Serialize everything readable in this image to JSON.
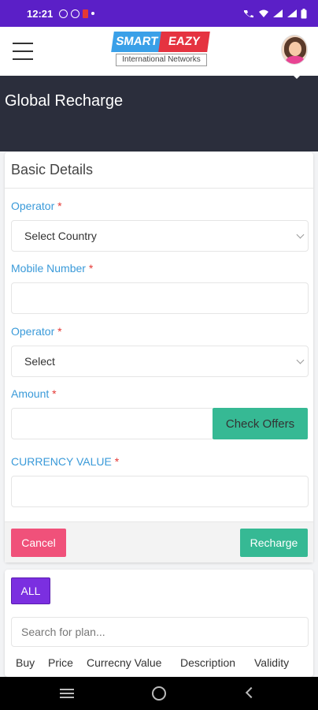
{
  "statusbar": {
    "time": "12:21"
  },
  "header": {
    "logo_left": "SMART",
    "logo_right": "EAZY",
    "logo_sub": "International Networks"
  },
  "page": {
    "title": "Global Recharge"
  },
  "form": {
    "section_title": "Basic Details",
    "operator_country_label": "Operator",
    "country_select_value": "Select Country",
    "mobile_label": "Mobile Number",
    "mobile_value": "",
    "operator_label": "Operator",
    "operator_select_value": "Select",
    "amount_label": "Amount",
    "amount_value": "",
    "check_offers": "Check Offers",
    "currency_label": "CURRENCY VALUE",
    "currency_value": "",
    "required_mark": "*",
    "cancel": "Cancel",
    "recharge": "Recharge"
  },
  "plans": {
    "all_button": "ALL",
    "search_placeholder": "Search for plan...",
    "columns": [
      "Buy",
      "Price",
      "Currecny Value",
      "Description",
      "Validity"
    ]
  },
  "colors": {
    "statusbar": "#5b1fc7",
    "banner": "#2b2e3c",
    "label": "#3a9ad9",
    "success": "#36b994",
    "danger": "#f0517a",
    "all_button": "#7b2fe0"
  }
}
